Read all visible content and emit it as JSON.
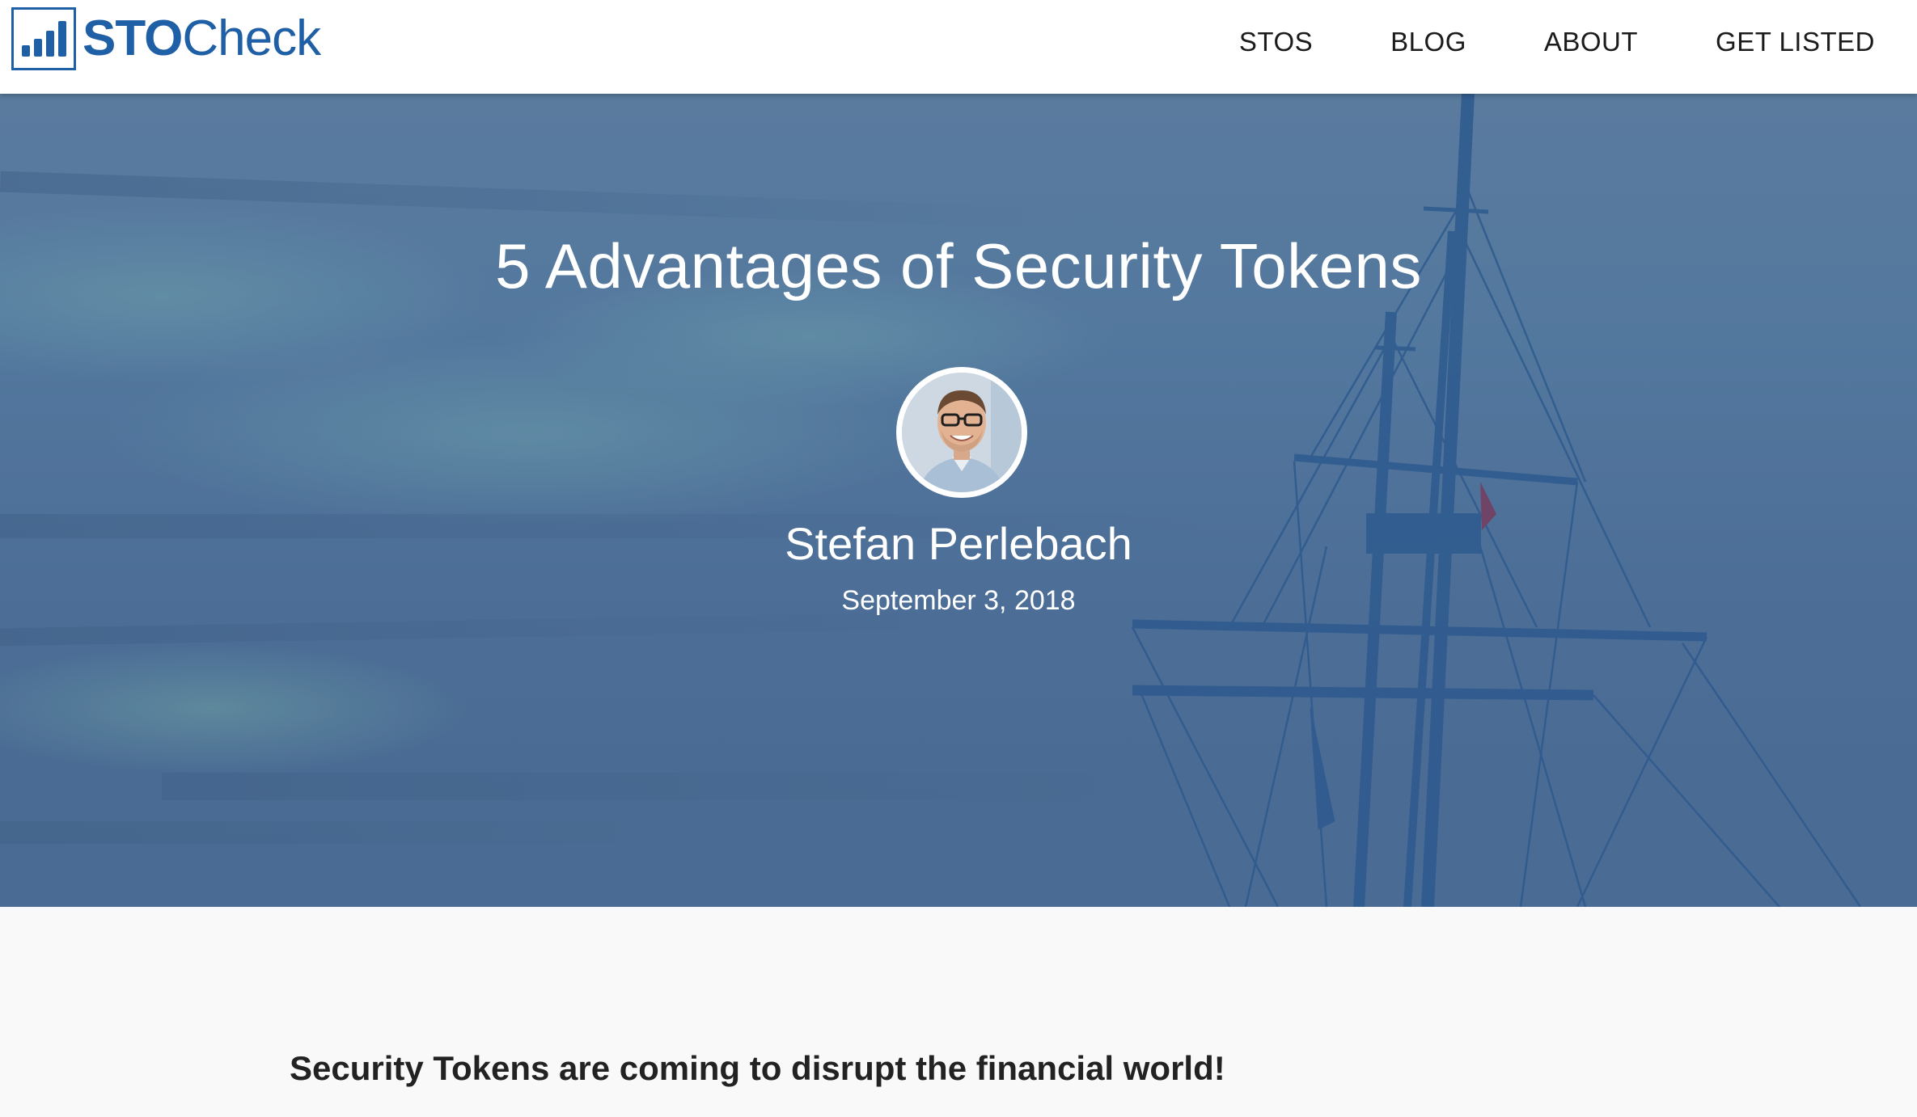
{
  "brand": {
    "name_bold": "STO",
    "name_light": "Check",
    "icon": "bar-chart-logo-icon",
    "color": "#1f5fa6"
  },
  "nav": {
    "items": [
      {
        "label": "STOS"
      },
      {
        "label": "BLOG"
      },
      {
        "label": "ABOUT"
      },
      {
        "label": "GET LISTED"
      }
    ]
  },
  "hero": {
    "title": "5 Advantages of Security Tokens",
    "author": "Stefan Perlebach",
    "date": "September 3, 2018",
    "overlay_color": "#4e6f97"
  },
  "article": {
    "lead": "Security Tokens are coming to disrupt the financial world!"
  }
}
